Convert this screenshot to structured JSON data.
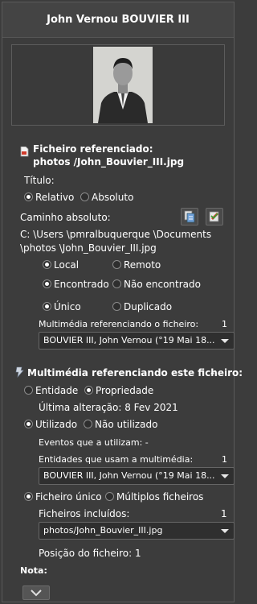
{
  "header": {
    "title": "John Vernou BOUVIER III"
  },
  "file_section": {
    "heading_line1": "Ficheiro referenciado:",
    "heading_line2": "photos /John_Bouvier_III.jpg",
    "title_label": "Título:",
    "relative_label": "Relativo",
    "absolute_label": "Absoluto",
    "abs_path_label": "Caminho absoluto:",
    "path_line1": "C: \\Users \\pmralbuquerque \\Documents",
    "path_line2": "\\photos \\John_Bouvier_III.jpg",
    "local_label": "Local",
    "remote_label": "Remoto",
    "found_label": "Encontrado",
    "not_found_label": "Não encontrado",
    "unique_label": "Único",
    "duplicate_label": "Duplicado",
    "ref_media_label": "Multimédia referenciando o ficheiro:",
    "ref_media_count": "1",
    "ref_media_value": "BOUVIER III, John Vernou (°19 Mai 18..."
  },
  "media_section": {
    "heading": "Multimédia referenciando este ficheiro:",
    "heading_suffix": "-",
    "entity_label": "Entidade",
    "property_label": "Propriedade",
    "last_change": "Última alteração: 8 Fev 2021",
    "used_label": "Utilizado",
    "not_used_label": "Não utilizado",
    "events_label": "Eventos que a utilizam: -",
    "entities_label": "Entidades que usam a multimédia:",
    "entities_count": "1",
    "entities_value": "BOUVIER III, John Vernou (°19 Mai 18...",
    "single_file_label": "Ficheiro único",
    "multi_file_label": "Múltiplos ficheiros",
    "included_files_label": "Ficheiros incluídos:",
    "included_files_count": "1",
    "included_files_value": "photos/John_Bouvier_III.jpg",
    "file_position": "Posição do ficheiro: 1",
    "note_label": "Nota:"
  },
  "colors": {
    "background": "#3c3c3c",
    "text": "#ffffff",
    "combo_bg": "#2f2f2f"
  }
}
